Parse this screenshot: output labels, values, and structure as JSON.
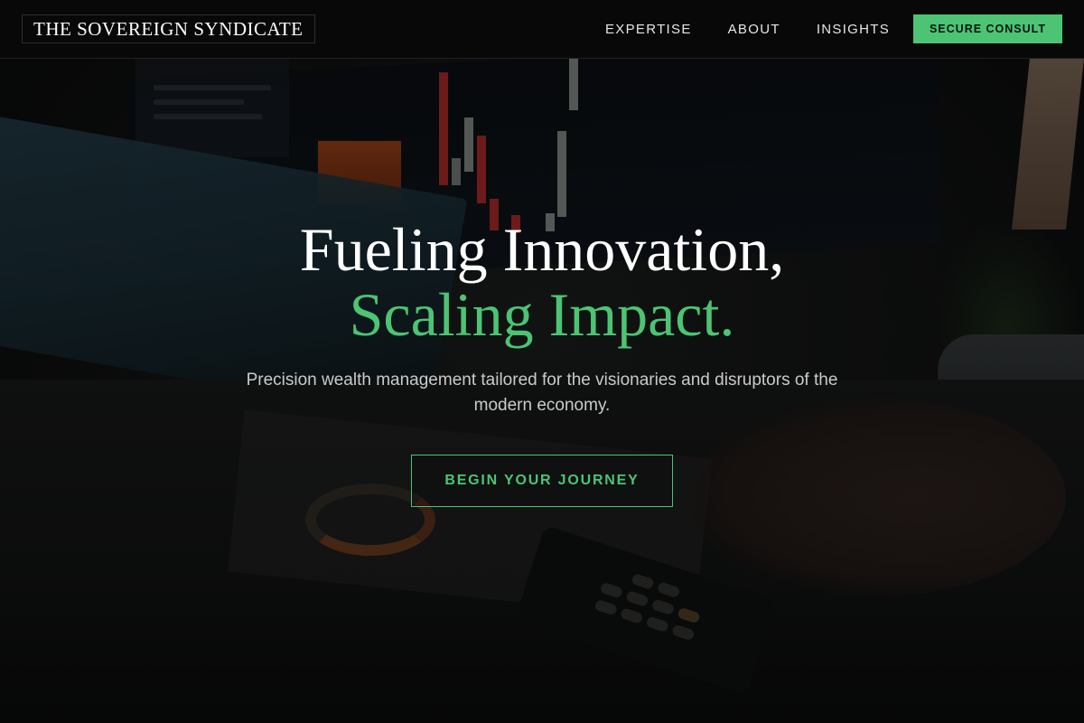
{
  "header": {
    "logo": "THE SOVEREIGN SYNDICATE",
    "nav": [
      {
        "label": "EXPERTISE"
      },
      {
        "label": "ABOUT"
      },
      {
        "label": "INSIGHTS"
      }
    ],
    "cta_label": "SECURE CONSULT"
  },
  "hero": {
    "title_line1": "Fueling Innovation,",
    "title_line2": "Scaling Impact.",
    "subtitle": "Precision wealth management tailored for the visionaries and disruptors of the modern economy.",
    "cta_label": "BEGIN YOUR JOURNEY"
  },
  "colors": {
    "accent": "#4cc473",
    "header_bg": "#080808",
    "text": "#ffffff"
  }
}
